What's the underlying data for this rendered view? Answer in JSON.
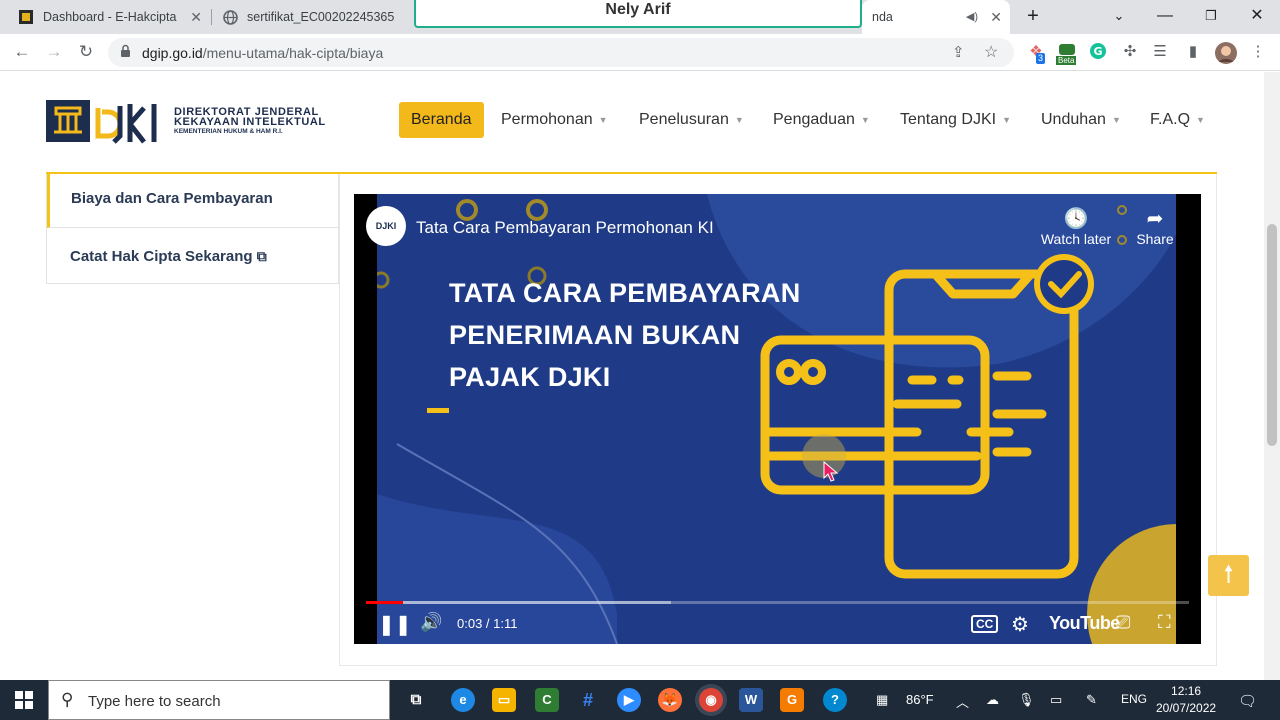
{
  "browser": {
    "tabs": [
      {
        "title": "Dashboard - E-Hakcipta"
      },
      {
        "title": "sertifikat_EC00202245365"
      },
      {
        "title": "nda"
      }
    ],
    "share_banner": "Nely Arif",
    "new_tab_symbol": "+",
    "url_host": "dgip.go.id",
    "url_path": "/menu-utama/hak-cipta/biaya",
    "extension_badge": "3",
    "beta_badge": "Beta"
  },
  "site": {
    "logo": {
      "wordmark": "DJKI",
      "line1": "DIREKTORAT JENDERAL",
      "line2": "KEKAYAAN INTELEKTUAL",
      "line3": "KEMENTERIAN HUKUM & HAM R.I."
    },
    "nav": [
      "Beranda",
      "Permohonan",
      "Penelusuran",
      "Pengaduan",
      "Tentang DJKI",
      "Unduhan",
      "F.A.Q"
    ],
    "sidebar": [
      {
        "label": "Biaya dan Cara Pembayaran"
      },
      {
        "label": "Catat Hak Cipta Sekarang"
      }
    ]
  },
  "video": {
    "title": "Tata Cara Pembayaran Permohonan KI",
    "channel_logo_text": "DJKI",
    "watch_later": "Watch later",
    "share": "Share",
    "headline": [
      "TATA CARA PEMBAYARAN",
      "PENERIMAAN BUKAN",
      "PAJAK DJKI"
    ],
    "time": "0:03 / 1:11",
    "youtube_label": "YouTube",
    "played_fraction": 0.045,
    "loaded_fraction": 0.37,
    "accent_color": "#f5c018",
    "bg_color": "#1f3a86"
  },
  "taskbar": {
    "search_placeholder": "Type here to search",
    "weather": "86°F",
    "language": "ENG",
    "time": "12:16",
    "date": "20/07/2022"
  }
}
